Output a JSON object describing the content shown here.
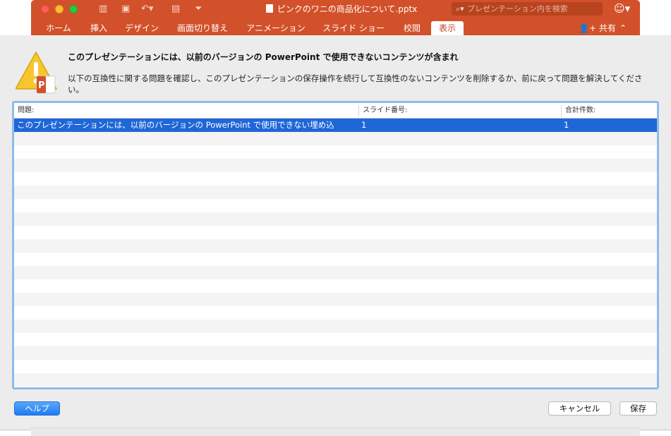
{
  "window": {
    "document_title": "ピンクのワニの商品化について.pptx",
    "search_placeholder": "プレゼンテーション内を検索"
  },
  "ribbon": {
    "tabs": [
      {
        "label": "ホーム"
      },
      {
        "label": "挿入"
      },
      {
        "label": "デザイン"
      },
      {
        "label": "画面切り替え"
      },
      {
        "label": "アニメーション"
      },
      {
        "label": "スライド ショー"
      },
      {
        "label": "校閲"
      },
      {
        "label": "表示",
        "active": true
      }
    ],
    "share_label": "共有"
  },
  "dialog": {
    "heading": "このプレゼンテーションには、以前のバージョンの PowerPoint で使用できないコンテンツが含まれ",
    "description": "以下の互換性に関する問題を確認し、このプレゼンテーションの保存操作を続行して互換性のないコンテンツを削除するか、前に戻って問題を解決してください。",
    "table": {
      "columns": [
        "問題:",
        "スライド番号:",
        "合計件数:"
      ],
      "rows": [
        {
          "issue": "このプレゼンテーションには、以前のバージョンの PowerPoint で使用できない埋め込",
          "slide_number": "1",
          "total_count": "1",
          "selected": true
        }
      ]
    },
    "buttons": {
      "help": "ヘルプ",
      "cancel": "キャンセル",
      "save": "保存"
    }
  },
  "colors": {
    "accent_ribbon": "#d2512a",
    "selection": "#1f66d9",
    "table_focus": "#8ebbea"
  }
}
